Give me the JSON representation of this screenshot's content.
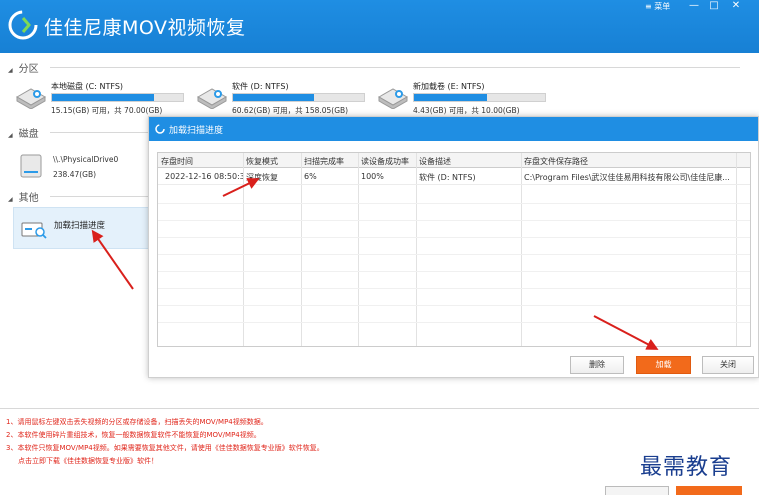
{
  "app": {
    "title": "佳佳尼康MOV视频恢复",
    "menu_label": "菜单",
    "minimize_glyph": "—",
    "maximize_glyph": "□",
    "close_glyph": "✕"
  },
  "sections": {
    "partition": "分区",
    "disk": "磁盘",
    "other": "其他"
  },
  "partitions": [
    {
      "name": "本地磁盘 (C: NTFS)",
      "capacity": "15.15(GB) 可用，共 70.00(GB)",
      "used_fraction": 0.78
    },
    {
      "name": "软件 (D: NTFS)",
      "capacity": "60.62(GB) 可用，共 158.05(GB)",
      "used_fraction": 0.62
    },
    {
      "name": "新加载卷 (E: NTFS)",
      "capacity": "4.43(GB) 可用，共 10.00(GB)",
      "used_fraction": 0.56
    }
  ],
  "physical_drive": {
    "name": "\\\\.\\PhysicalDrive0",
    "capacity": "238.47(GB)"
  },
  "other_item": {
    "label": "加载扫描进度"
  },
  "dialog": {
    "title": "加载扫描进度",
    "columns": [
      "存盘时间",
      "恢复模式",
      "扫描完成率",
      "读设备成功率",
      "设备描述",
      "存盘文件保存路径"
    ],
    "rows": [
      [
        "2022-12-16 08:50:30",
        "深度恢复",
        "6%",
        "100%",
        "软件 (D: NTFS)",
        "C:\\Program Files\\武汉佳佳易用科技有限公司\\佳佳尼康..."
      ]
    ],
    "buttons": {
      "delete": "删除",
      "load": "加载",
      "close": "关闭"
    }
  },
  "notes": [
    "1、请用鼠标左键双击丢失视频的分区或存储设备，扫描丢失的MOV/MP4视频数据。",
    "2、本软件使用碎片重组技术，恢复一般数据恢复软件不能恢复的MOV/MP4视频。",
    "3、本软件只恢复MOV/MP4视频。如果需要恢复其他文件，请使用《佳佳数据恢复专业版》软件恢复。",
    "点击立即下载《佳佳数据恢复专业版》软件！"
  ],
  "watermark": "最需教育",
  "colors": {
    "accent": "#1f8ee3",
    "primary_button": "#f26a1b",
    "note_text": "#e0261b",
    "annotation_arrow": "#d9201c"
  }
}
